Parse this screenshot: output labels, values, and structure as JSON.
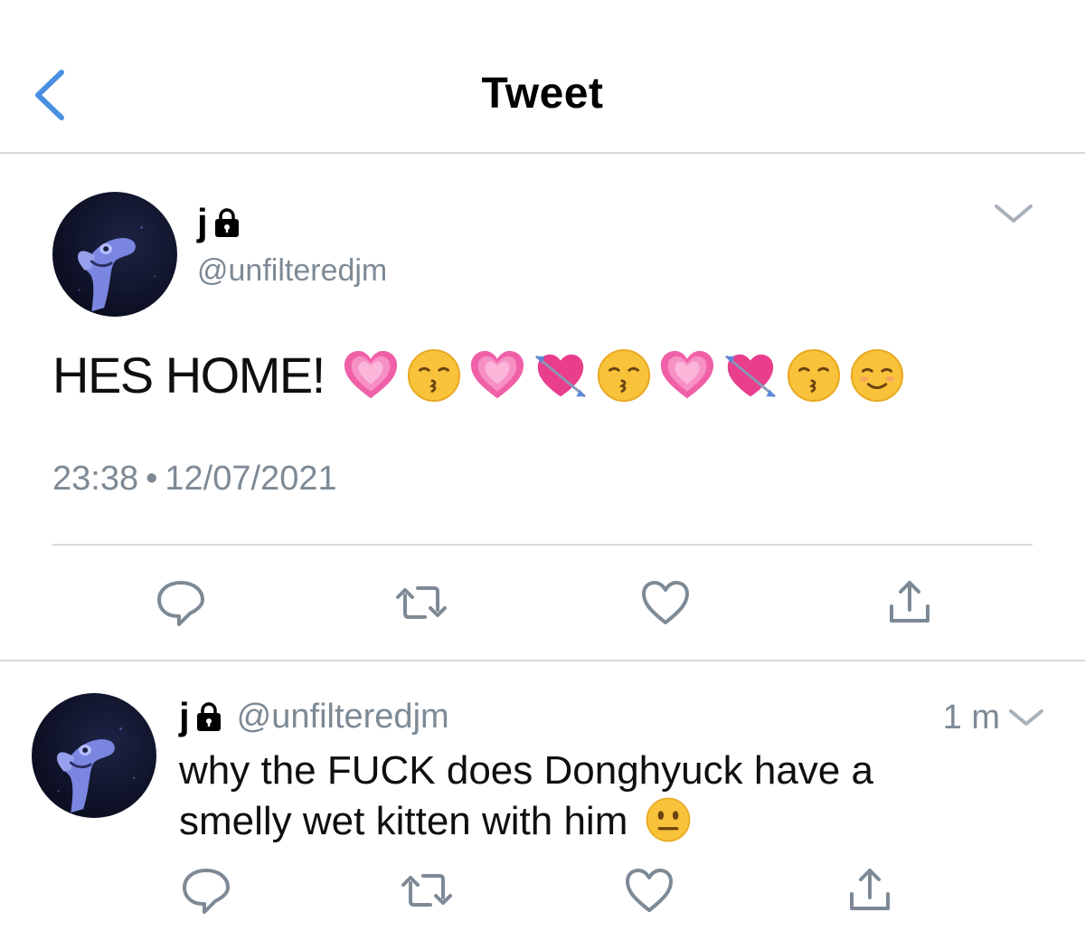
{
  "nav": {
    "title": "Tweet"
  },
  "tweet": {
    "author_name": "j",
    "author_handle": "@unfilteredjm",
    "text": "HES HOME!",
    "emojis": [
      "growing-heart",
      "kissing-face",
      "growing-heart",
      "heart-with-arrow",
      "kissing-face",
      "growing-heart",
      "heart-with-arrow",
      "kissing-face",
      "smiling-face"
    ],
    "time": "23:38",
    "separator": "•",
    "date": "12/07/2021"
  },
  "reply": {
    "author_name": "j",
    "author_handle": "@unfilteredjm",
    "time": "1 m",
    "text": "why the FUCK does Donghyuck have a smelly wet kitten with him",
    "emoji": "neutral-face"
  },
  "colors": {
    "accent": "#4a90e2",
    "muted": "#7d8a96",
    "divider": "#d6d6d6",
    "icon": "#7d8a96"
  }
}
